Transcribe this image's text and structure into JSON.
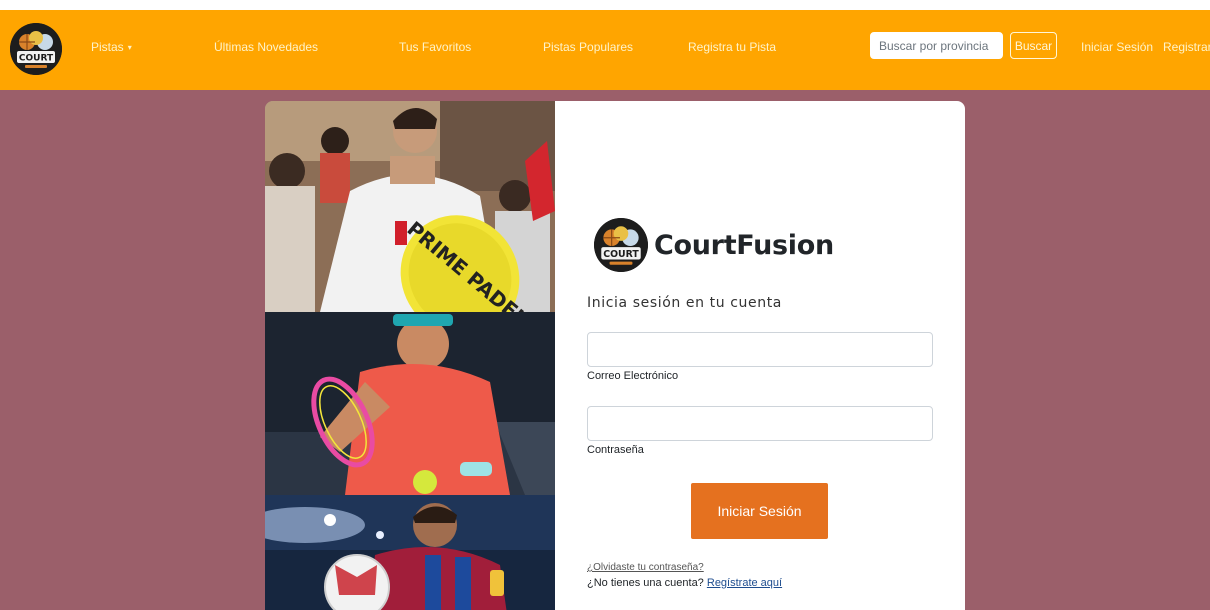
{
  "navbar": {
    "logo_text": "COURT",
    "items": [
      {
        "label": "Pistas",
        "caret": "▾"
      },
      {
        "label": "Últimas Novedades"
      },
      {
        "label": "Tus Favoritos"
      },
      {
        "label": "Pistas Populares"
      },
      {
        "label": "Registra tu Pista"
      }
    ],
    "search": {
      "placeholder": "Buscar por provincia",
      "value": "",
      "button_label": "Buscar"
    },
    "login_label": "Iniciar Sesión",
    "register_label": "Registrarse"
  },
  "login": {
    "brand_name": "CourtFusion",
    "logo_text": "COURT",
    "subtitle": "Inicia sesión en tu cuenta",
    "email": {
      "label": "Correo Electrónico",
      "value": ""
    },
    "password": {
      "label": "Contraseña",
      "value": ""
    },
    "submit_label": "Iniciar Sesión",
    "forgot_password": "¿Olvidaste tu contraseña?",
    "no_account": "¿No tienes una cuenta?",
    "register_link": "Regístrate aquí"
  },
  "photos": {
    "racket_text": "PRIME PADEL"
  },
  "colors": {
    "navbar": "#ffa500",
    "background": "#9b5f6a",
    "button": "#e5711f",
    "card": "#ffffff"
  },
  "icons": {
    "nav_logo": "court-logo-icon",
    "brand_logo": "court-logo-icon",
    "dropdown": "caret-down-icon"
  }
}
